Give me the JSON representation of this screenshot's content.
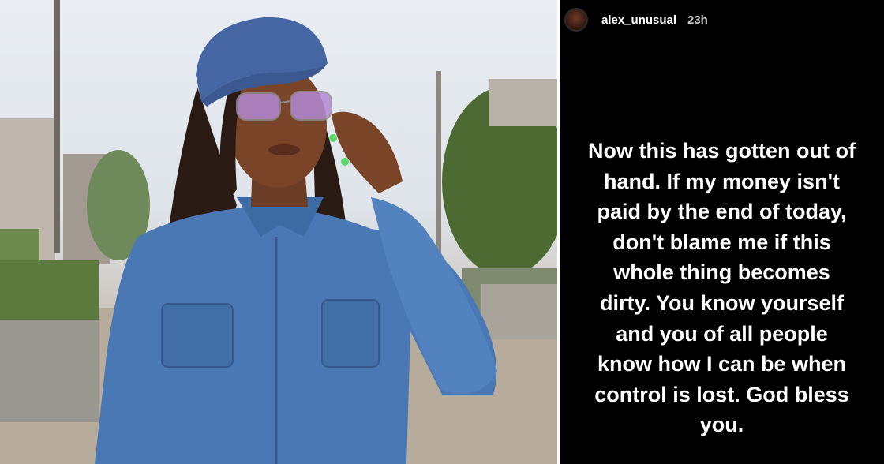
{
  "story": {
    "username": "alex_unusual",
    "time": "23h",
    "lines": [
      "Now this has gotten out of",
      "hand. If my money isn't",
      "paid by the end of today,",
      "don't blame me if this",
      "whole thing becomes",
      "dirty. You know yourself",
      "and you of all people",
      "know how I can be when",
      "control is lost.  God bless",
      "you."
    ]
  },
  "colors": {
    "story_background": "#000000",
    "story_text": "#ffffff",
    "denim": "#4a78b4",
    "cap": "#4565a3"
  }
}
